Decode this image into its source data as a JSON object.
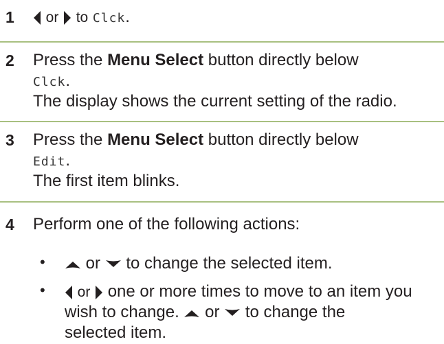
{
  "steps": [
    {
      "number": "1",
      "or": "or",
      "to": "to",
      "code": "Clck",
      "end": "."
    },
    {
      "number": "2",
      "press": "Press the",
      "button_name": "Menu Select",
      "rest": "button directly below",
      "code": "Clck",
      "end": ".",
      "result": "The display shows the current setting of the radio."
    },
    {
      "number": "3",
      "press": "Press the",
      "button_name": "Menu Select",
      "rest": "button directly below",
      "code": "Edit",
      "end": ".",
      "result": "The first item blinks."
    },
    {
      "number": "4",
      "text": "Perform one of the following actions:",
      "bullets": [
        {
          "or": "or",
          "text": "to change the selected item."
        },
        {
          "or": "or",
          "line1": "one or more times to move to an item you",
          "line2a": "wish to change.",
          "line2_or": "or",
          "line2b": "to change the",
          "line3": "selected item."
        }
      ]
    }
  ],
  "colors": {
    "rule": "#a8c080",
    "text": "#231f20"
  },
  "icons": [
    "left-arrow-icon",
    "right-arrow-icon",
    "up-arrow-icon",
    "down-arrow-icon"
  ]
}
